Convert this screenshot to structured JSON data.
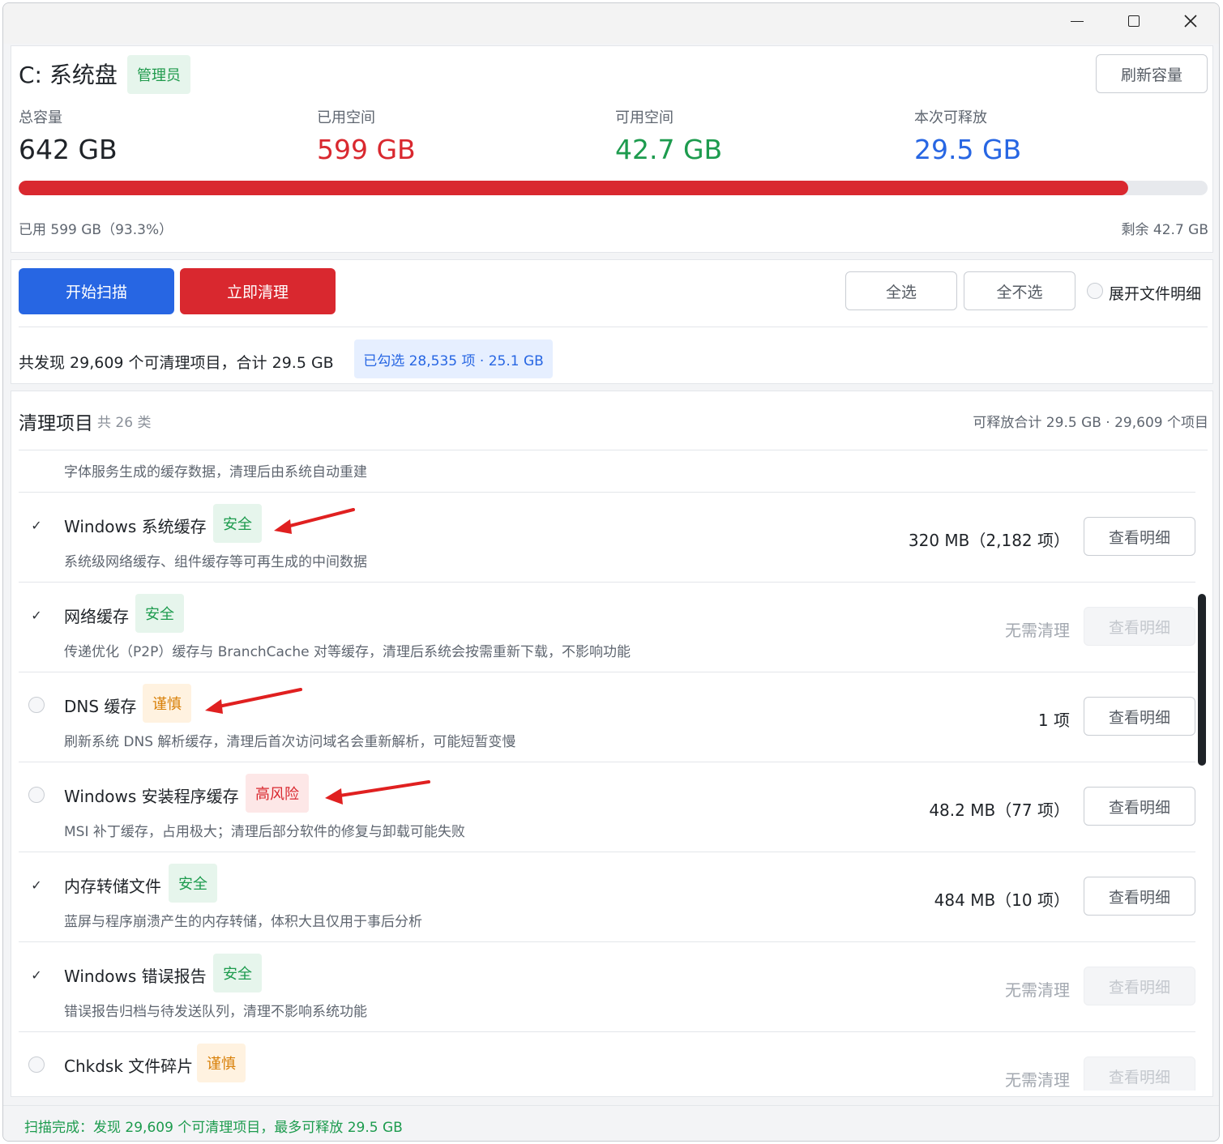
{
  "window": {
    "controls": {
      "minimize": "minimize-icon",
      "maximize": "maximize-icon",
      "close": "close-icon"
    }
  },
  "disk": {
    "title": "C: 系统盘",
    "badge": "管理员",
    "refresh_label": "刷新容量",
    "stats": [
      {
        "label": "总容量",
        "value": "642 GB",
        "color": "#1f2328"
      },
      {
        "label": "已用空间",
        "value": "599 GB",
        "color": "#d9282f"
      },
      {
        "label": "可用空间",
        "value": "42.7 GB",
        "color": "#1d9b4e"
      },
      {
        "label": "本次可释放",
        "value": "29.5 GB",
        "color": "#2766e3"
      }
    ],
    "used_percent": 93.3,
    "used_text": "已用 599 GB（93.3%）",
    "remaining_text": "剩余 42.7 GB"
  },
  "actions": {
    "scan_label": "开始扫描",
    "clean_label": "立即清理",
    "select_all_label": "全选",
    "select_none_label": "全不选",
    "expand_label": "展开文件明细",
    "summary": "共发现 29,609 个可清理项目，合计 29.5 GB",
    "selected": "已勾选 28,535 项 · 25.1 GB"
  },
  "list": {
    "title": "清理项目",
    "count": "共 26 类",
    "total": "可释放合计 29.5 GB · 29,609 个项目",
    "partial_top_desc": "字体服务生成的缓存数据，清理后由系统自动重建",
    "items": [
      {
        "name": "Windows 系统缓存",
        "tag": "安全",
        "level": "safe",
        "checked": true,
        "desc": "系统级网络缓存、组件缓存等可再生成的中间数据",
        "size": "320 MB（2,182 项）",
        "detail": "查看明细",
        "detail_enabled": true
      },
      {
        "name": "网络缓存",
        "tag": "安全",
        "level": "safe",
        "checked": true,
        "desc": "传递优化（P2P）缓存与 BranchCache 对等缓存，清理后系统会按需重新下载，不影响功能",
        "size": "无需清理",
        "detail": "查看明细",
        "detail_enabled": false
      },
      {
        "name": "DNS 缓存",
        "tag": "谨慎",
        "level": "caution",
        "checked": false,
        "desc": "刷新系统 DNS 解析缓存，清理后首次访问域名会重新解析，可能短暂变慢",
        "size": "1 项",
        "detail": "查看明细",
        "detail_enabled": true
      },
      {
        "name": "Windows 安装程序缓存",
        "tag": "高风险",
        "level": "risk",
        "checked": false,
        "desc": "MSI 补丁缓存，占用极大；清理后部分软件的修复与卸载可能失败",
        "size": "48.2 MB（77 项）",
        "detail": "查看明细",
        "detail_enabled": true
      },
      {
        "name": "内存转储文件",
        "tag": "安全",
        "level": "safe",
        "checked": true,
        "desc": "蓝屏与程序崩溃产生的内存转储，体积大且仅用于事后分析",
        "size": "484 MB（10 项）",
        "detail": "查看明细",
        "detail_enabled": true
      },
      {
        "name": "Windows 错误报告",
        "tag": "安全",
        "level": "safe",
        "checked": true,
        "desc": "错误报告归档与待发送队列，清理不影响系统功能",
        "size": "无需清理",
        "detail": "查看明细",
        "detail_enabled": false
      },
      {
        "name": "Chkdsk 文件碎片",
        "tag": "谨慎",
        "level": "caution",
        "checked": false,
        "desc": "",
        "size": "无需清理",
        "detail": "查看明细",
        "detail_enabled": false
      }
    ]
  },
  "status": {
    "text": "扫描完成：发现 29,609 个可清理项目，最多可释放 29.5 GB"
  }
}
